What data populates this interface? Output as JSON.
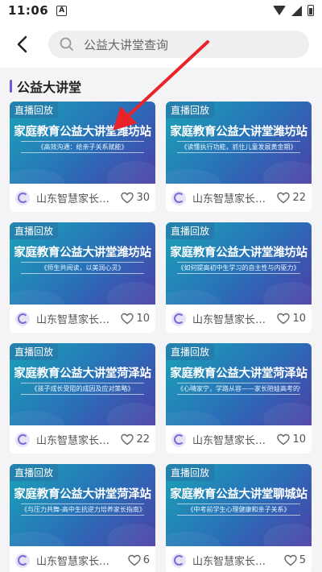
{
  "status": {
    "time": "11:06",
    "notif_letter": "A"
  },
  "topbar": {
    "search_placeholder": "公益大讲堂查询"
  },
  "section": {
    "title": "公益大讲堂"
  },
  "cards": [
    {
      "badge": "直播回放",
      "headline": "家庭教育公益大讲堂潍坊站",
      "subtitle": "《高效沟通：给亲子关系赋能》",
      "source": "山东智慧家长…",
      "likes": "30"
    },
    {
      "badge": "直播回放",
      "headline": "家庭教育公益大讲堂潍坊站",
      "subtitle": "《读懂执行功能，抓住儿童发展黄金期》",
      "source": "山东智慧家长…",
      "likes": "22"
    },
    {
      "badge": "直播回放",
      "headline": "家庭教育公益大讲堂潍坊站",
      "subtitle": "《师生共阅读，以美润心灵》",
      "source": "山东智慧家长…",
      "likes": "10"
    },
    {
      "badge": "直播回放",
      "headline": "家庭教育公益大讲堂潍坊站",
      "subtitle": "《如何提高初中生学习的自主性与内驱力》",
      "source": "山东智慧家长…",
      "likes": "10"
    },
    {
      "badge": "直播回放",
      "headline": "家庭教育公益大讲堂菏泽站",
      "subtitle": "《孩子成长受阻的成因及应对策略》",
      "source": "山东智慧家长…",
      "likes": "22"
    },
    {
      "badge": "直播回放",
      "headline": "家庭教育公益大讲堂菏泽站",
      "subtitle": "《心晴家宁，学路从容——家长陪娃高考的情绪自治与减压》",
      "source": "山东智慧家长…",
      "likes": "10"
    },
    {
      "badge": "直播回放",
      "headline": "家庭教育公益大讲堂菏泽站",
      "subtitle": "《与压力共舞-高中生抗逆力培养家长指南》",
      "source": "山东智慧家长学院",
      "likes": "6"
    },
    {
      "badge": "直播回放",
      "headline": "家庭教育公益大讲堂聊城站",
      "subtitle": "《中考前学生心理健康和亲子关系》",
      "source": "山东智慧家长学院",
      "likes": "5"
    }
  ],
  "colors": {
    "accent": "#6b5bd6",
    "arrow": "#e8242a"
  }
}
